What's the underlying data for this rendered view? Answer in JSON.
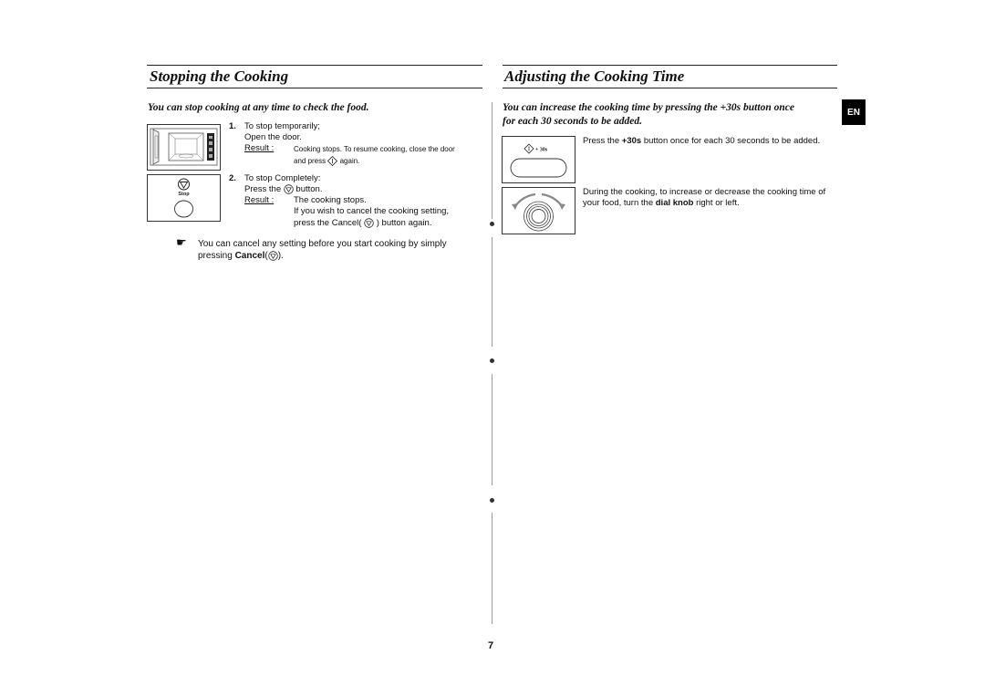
{
  "left": {
    "title": "Stopping the Cooking",
    "subhead": "You can stop cooking at any time to check the food.",
    "step1": {
      "number": "1.",
      "line1": "To stop temporarily;",
      "line2": "Open the door.",
      "result_label": "Result :",
      "result_line1": "Cooking stops. To resume cooking, close the door",
      "result_line2_pre": "and press",
      "result_line2_post": "again.",
      "icon": "start-icon"
    },
    "step2": {
      "number": "2.",
      "line1": "To stop Completely:",
      "line2_pre": "Press the",
      "line2_post": "button.",
      "result_label": "Result :",
      "result_line1": "The cooking stops.",
      "result_line2": "If you wish to cancel the cooking setting,",
      "result_line3_pre": "press the Cancel(",
      "result_line3_post": ") button again.",
      "icon": "stop-icon"
    },
    "illus_stop_label": "Stop",
    "note": {
      "icon": "pointing-hand-icon",
      "line1": "You can cancel any setting before you start cooking by simply",
      "line2_pre": "pressing ",
      "line2_bold": "Cancel",
      "line2_post": ")."
    }
  },
  "right": {
    "title": "Adjusting the Cooking Time",
    "subhead_line1": "You can increase the cooking time by pressing the +30s button once",
    "subhead_line2": "for each 30 seconds to be added.",
    "item1": {
      "pre": "Press the ",
      "bold": "+30s",
      "post": " button once for each 30 seconds to be added."
    },
    "illus_30s_label": "+ 30s",
    "item2": {
      "line1": "During the cooking, to increase or decrease the cooking time of",
      "line2_pre": "your food, turn the ",
      "line2_bold": "dial knob",
      "line2_post": " right or left."
    }
  },
  "language_badge": "EN",
  "page_number": "7"
}
